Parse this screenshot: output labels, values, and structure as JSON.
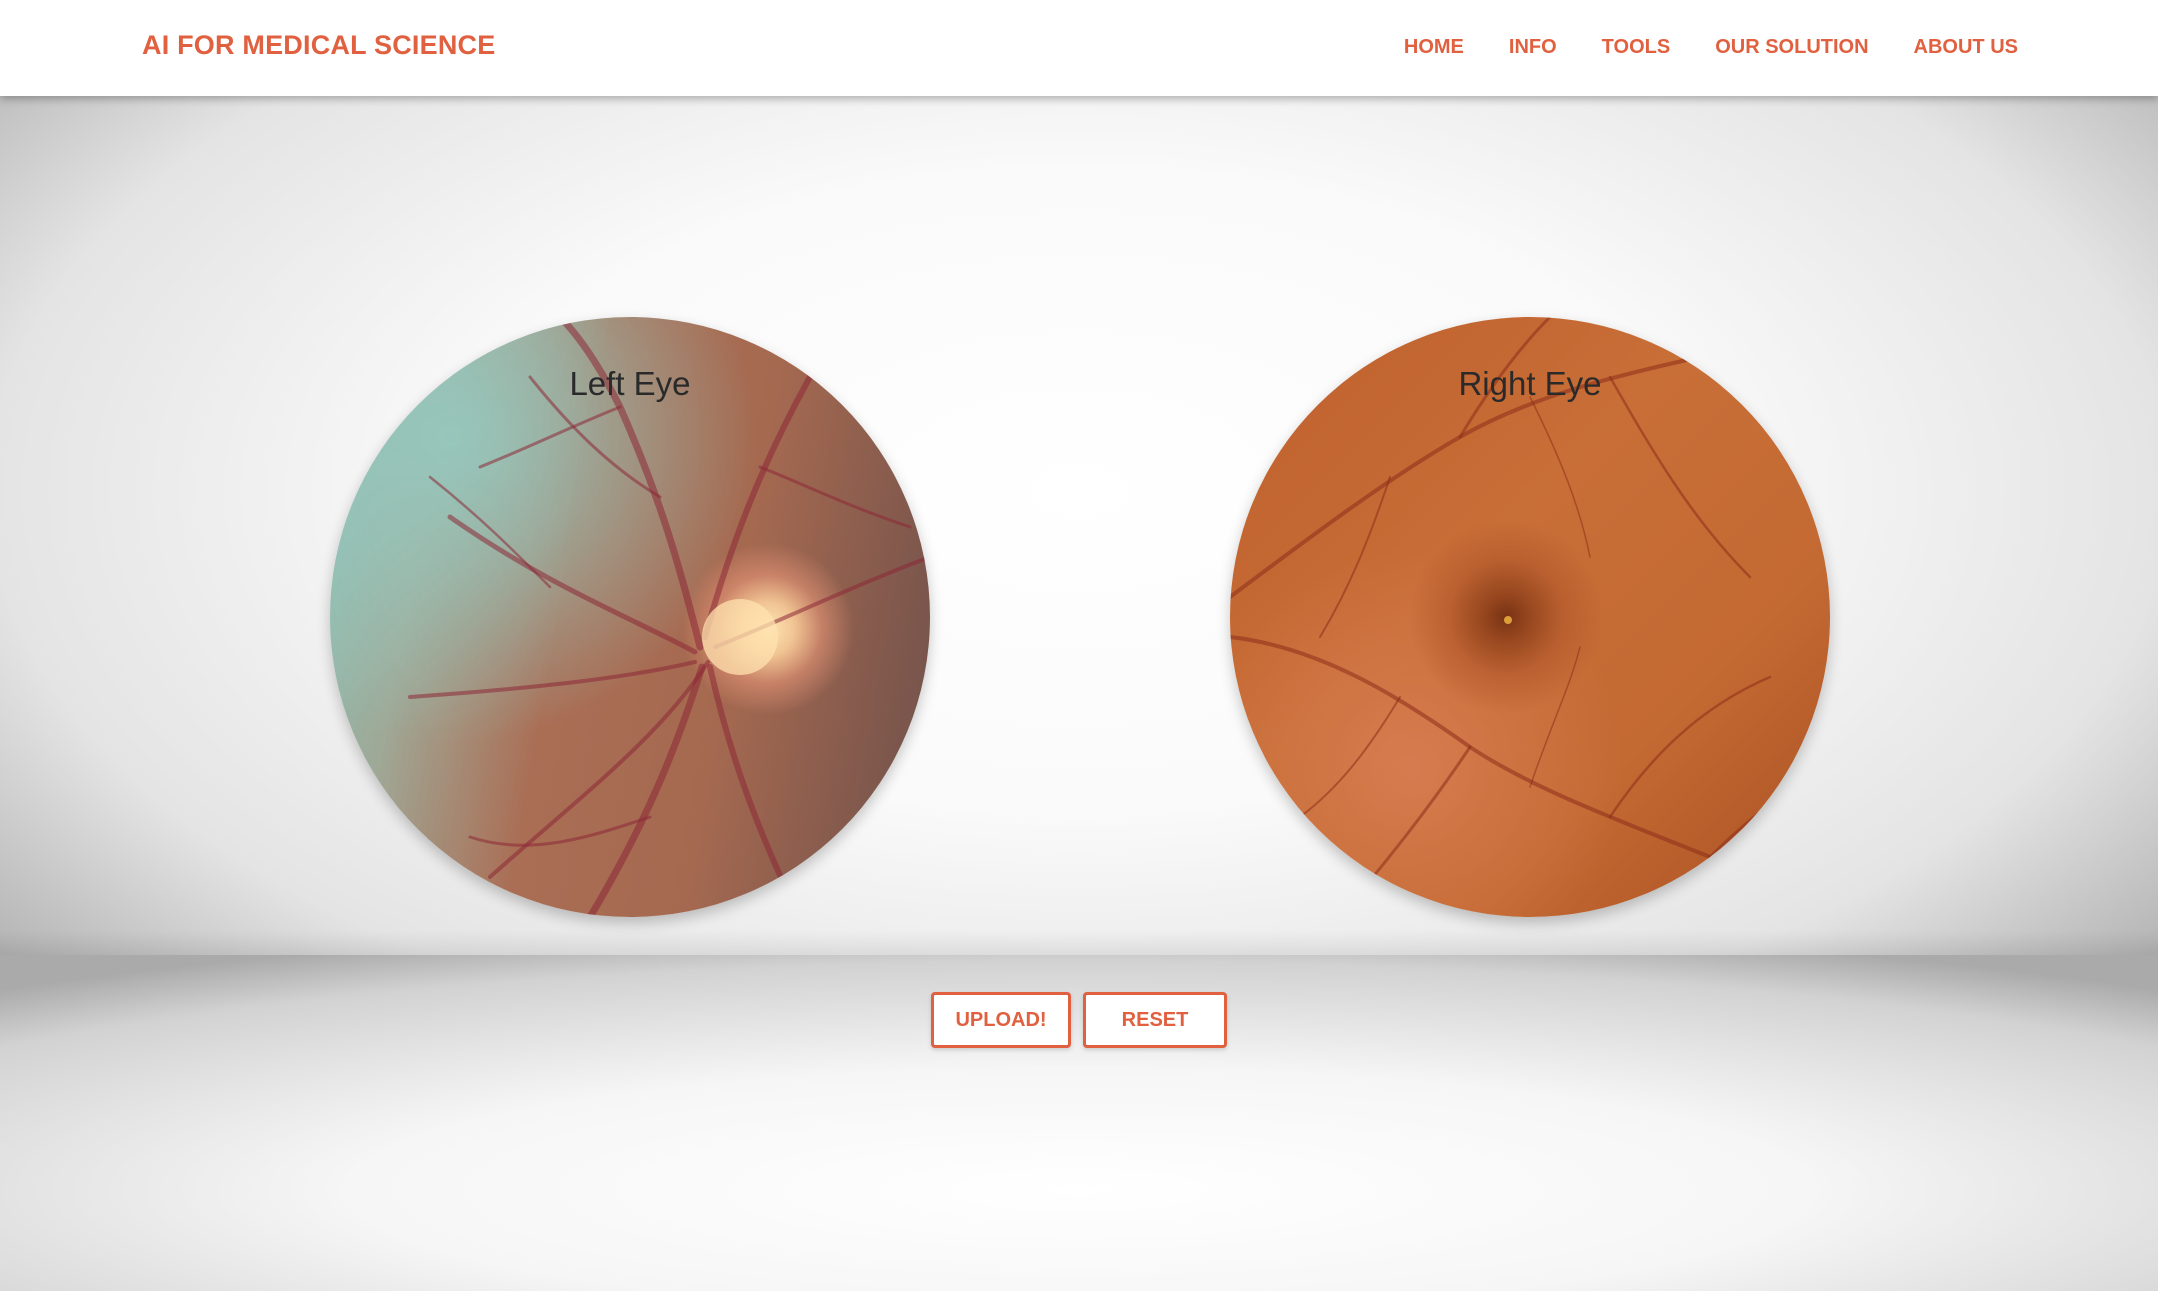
{
  "header": {
    "brand": "AI FOR MEDICAL SCIENCE",
    "nav": [
      "HOME",
      "INFO",
      "TOOLS",
      "OUR SOLUTION",
      "ABOUT US"
    ]
  },
  "eyes": {
    "left": {
      "label": "Left Eye"
    },
    "right": {
      "label": "Right Eye"
    }
  },
  "actions": {
    "upload": "UPLOAD!",
    "reset": "RESET"
  },
  "colors": {
    "accent": "#e0603f",
    "header_bg": "#ffffff",
    "label_text": "#2a2a2a"
  },
  "icons": {
    "left_eye_image": "retina-fundus-left",
    "right_eye_image": "retina-fundus-right"
  }
}
